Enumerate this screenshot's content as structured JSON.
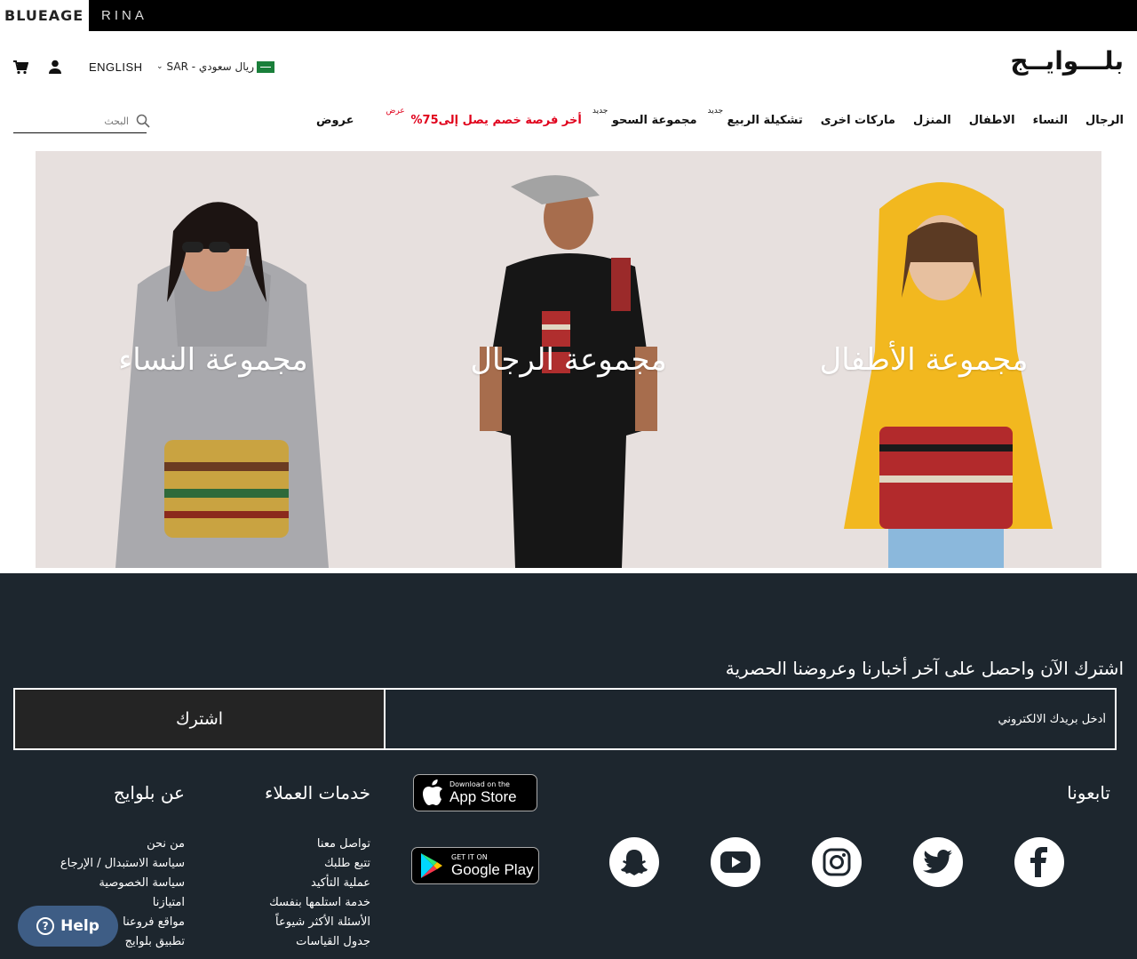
{
  "topbar": {
    "brand1": "BLUEAGE",
    "brand2": "RINA"
  },
  "header": {
    "logo_text": "بلـــوايــج",
    "language": "ENGLISH",
    "currency": "SAR - ريال سعودي"
  },
  "nav": {
    "items": [
      {
        "label": "الرجال",
        "badge": ""
      },
      {
        "label": "النساء",
        "badge": ""
      },
      {
        "label": "الاطفال",
        "badge": ""
      },
      {
        "label": "المنزل",
        "badge": ""
      },
      {
        "label": "ماركات اخرى",
        "badge": ""
      },
      {
        "label": "تشكيلة الربيع",
        "badge": "جديد"
      },
      {
        "label": "مجموعة السحو",
        "badge": "جديد"
      },
      {
        "label": "أخر فرصة خصم يصل إلى75%",
        "badge": "عرض"
      },
      {
        "label": "عروض",
        "badge": ""
      }
    ],
    "search_placeholder": "البحث"
  },
  "hero": {
    "panels": [
      {
        "title": "مجموعة الأطفال"
      },
      {
        "title": "مجموعة الرجال"
      },
      {
        "title": "مجموعة النساء"
      }
    ]
  },
  "footer": {
    "subscribe_title": "اشترك الآن واحصل على آخر أخبارنا وعروضنا الحصرية",
    "email_placeholder": "أدخل بريدك الالكتروني",
    "subscribe_button": "اشترك",
    "follow_title": "تابعونا",
    "social": [
      "facebook-icon",
      "twitter-icon",
      "instagram-icon",
      "youtube-icon",
      "snapchat-icon"
    ],
    "appstore": {
      "small": "Download on the",
      "big": "App Store"
    },
    "googleplay": {
      "small": "GET IT ON",
      "big": "Google Play"
    },
    "customer_service": {
      "title": "خدمات العملاء",
      "links": [
        "تواصل معنا",
        "تتبع طلبك",
        "عملية التأكيد",
        "خدمة استلمها بنفسك",
        "الأسئلة الأكثر شيوعاً",
        "جدول القياسات"
      ]
    },
    "about": {
      "title": "عن بلوايج",
      "links": [
        "من نحن",
        "سياسة الاستبدال / الإرجاع",
        "سياسة الخصوصية",
        "امتيازنا",
        "مواقع فروعنا",
        "تطبيق بلوايج"
      ]
    },
    "help_label": "Help"
  },
  "colors": {
    "footer_bg": "#1d262e",
    "sale_red": "#e0001b",
    "hero_bg": "#e7e0de",
    "help_blue": "#3e5d85"
  }
}
